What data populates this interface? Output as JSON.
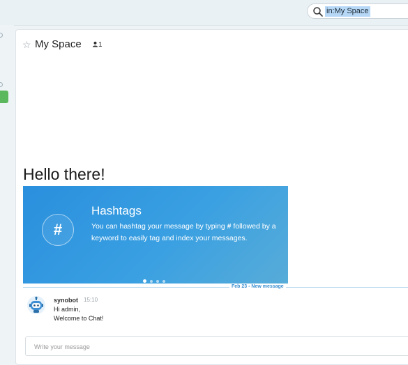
{
  "search": {
    "query": "in:My Space"
  },
  "channel": {
    "name": "My Space",
    "member_count": "1"
  },
  "welcome": {
    "heading": "Hello there!"
  },
  "carousel": {
    "title": "Hashtags",
    "description_before": "You can hashtag your message by typing ",
    "description_key": "#",
    "description_after": " followed by a keyword to easily tag and index your messages.",
    "page_count": 4,
    "active_page": 1
  },
  "divider": {
    "label": "Feb 23 - New message"
  },
  "message": {
    "sender": "synobot",
    "time": "15:10",
    "lines": [
      "Hi admin,",
      "Welcome to Chat!"
    ]
  },
  "composer": {
    "placeholder": "Write your message"
  },
  "colors": {
    "carousel_bg": "#2a8fdd",
    "accent": "#3a8fd0",
    "online_green": "#5cb85c"
  }
}
